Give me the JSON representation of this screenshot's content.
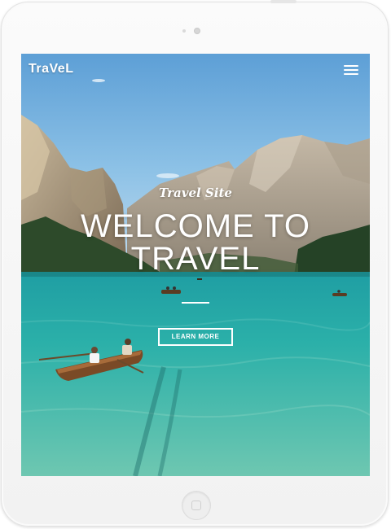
{
  "header": {
    "brand": "TraVeL",
    "menu_icon": "hamburger-menu-icon"
  },
  "hero": {
    "tagline": "Travel Site",
    "headline_line1": "WELCOME TO",
    "headline_line2": "TRAVEL",
    "cta_label": "LEARN MORE"
  },
  "colors": {
    "sky": "#7fb7e2",
    "water": "#33a7a0",
    "mountain": "#b9aa95",
    "forest": "#2f4a2a",
    "text": "#ffffff"
  }
}
